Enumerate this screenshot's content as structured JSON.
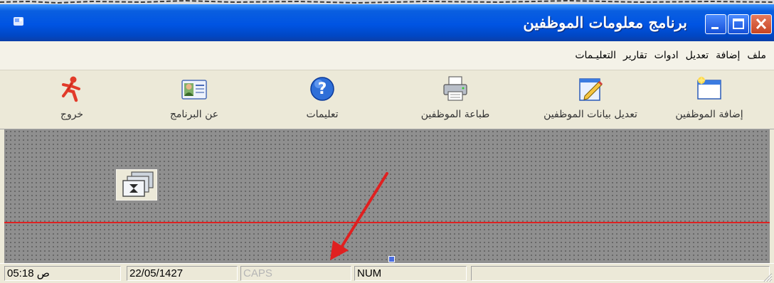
{
  "window": {
    "title": "برنامج معلومات الموظفين"
  },
  "menu": {
    "items": [
      "ملف",
      "إضافة",
      "تعديل",
      "ادوات",
      "تقارير",
      "التعليـمات"
    ]
  },
  "toolbar": {
    "buttons": [
      {
        "label": "إضافة الموظفين",
        "icon": "new-window-icon"
      },
      {
        "label": "تعديل بيانات الموظفين",
        "icon": "edit-pencil-icon"
      },
      {
        "label": "طباعة الموظفين",
        "icon": "printer-icon"
      },
      {
        "label": "تعليمات",
        "icon": "help-icon"
      },
      {
        "label": "عن البرنامج",
        "icon": "id-card-icon"
      },
      {
        "label": "خروج",
        "icon": "exit-running-man-icon"
      }
    ]
  },
  "statusbar": {
    "time": "05:18",
    "time_suffix": "ص",
    "date": "22/05/1427",
    "caps": "CAPS",
    "num": "NUM"
  },
  "colors": {
    "titlebar": "#0054e3",
    "client_bg": "#8f8f8f",
    "red_line": "#dd2222",
    "annotation_arrow": "#e02020"
  }
}
